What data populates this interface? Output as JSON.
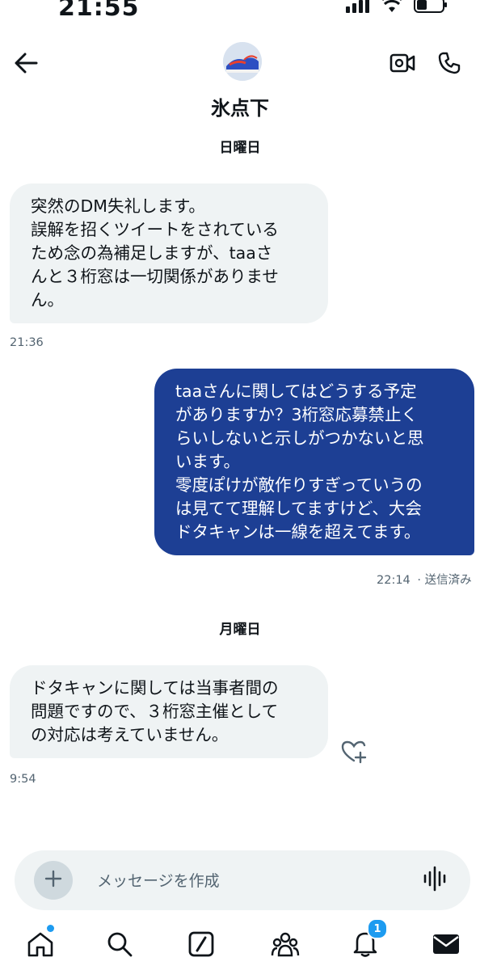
{
  "status_bar": {
    "time": "21:55"
  },
  "header": {
    "contact_name": "氷点下"
  },
  "conversation": {
    "day_sunday": "日曜日",
    "msg1": {
      "text": "突然のDM失礼します。\n誤解を招くツイートをされている\nため念の為補足しますが、taaさ\nんと３桁窓は一切関係がありませ\nん。",
      "time": "21:36"
    },
    "msg2": {
      "text": "taaさんに関してはどうする予定\nがありますか？3桁窓応募禁止く\nらいしないと示しがつかないと思\nいます。\n零度ぽけが敵作りすぎっていうの\nは見てて理解してますけど、大会\nドタキャンは一線を超えてます。",
      "time": "22:14",
      "status": "· 送信済み"
    },
    "day_monday": "月曜日",
    "msg3": {
      "text": "ドタキャンに関しては当事者間の\n問題ですので、３桁窓主催として\nの対応は考えていません。",
      "time": "9:54"
    }
  },
  "composer": {
    "placeholder": "メッセージを作成"
  },
  "bottom_nav": {
    "notifications_count": "1"
  },
  "icons": {
    "back": "arrow-left-icon",
    "video": "video-camera-icon",
    "call": "phone-icon",
    "react": "heart-plus-icon",
    "attach": "plus-icon",
    "voice": "waveform-icon",
    "home": "home-icon",
    "search": "search-icon",
    "grok": "grok-icon",
    "communities": "people-icon",
    "notifications": "bell-icon",
    "messages": "envelope-icon"
  },
  "colors": {
    "outgoing_bubble": "#1d3f94",
    "incoming_bubble": "#eff3f4",
    "accent": "#1d9bf0"
  }
}
